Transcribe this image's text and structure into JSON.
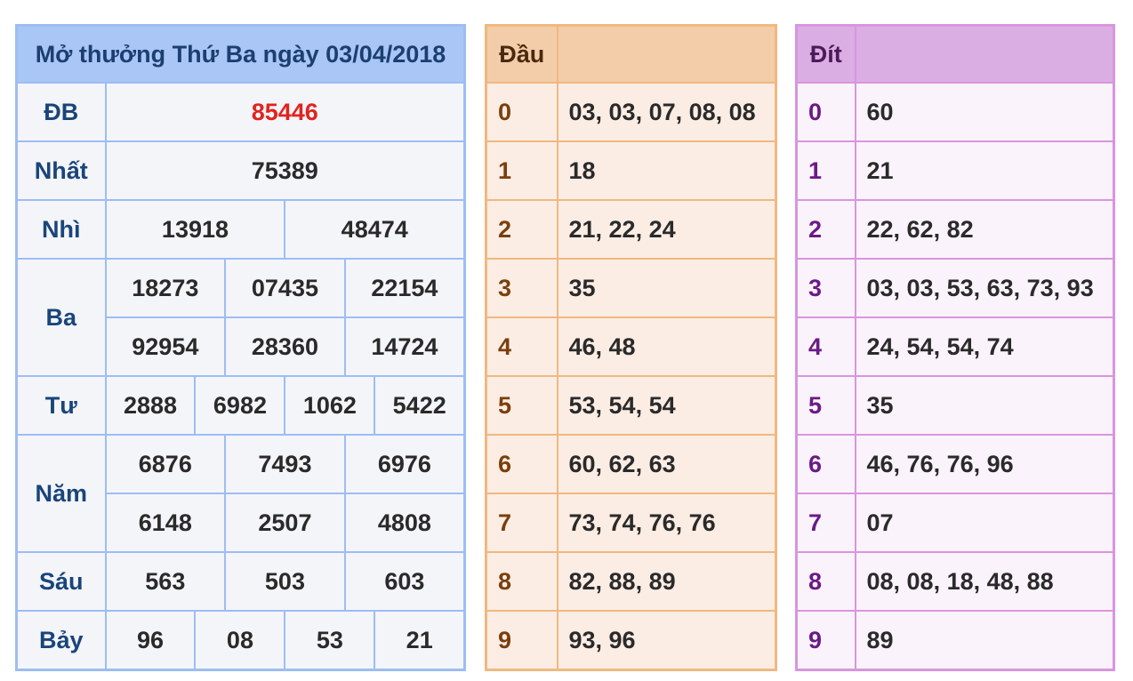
{
  "results": {
    "title": "Mở thưởng Thứ Ba ngày 03/04/2018",
    "db": {
      "label": "ĐB",
      "value": "85446"
    },
    "nhat": {
      "label": "Nhất",
      "value": "75389"
    },
    "nhi": {
      "label": "Nhì",
      "values": [
        "13918",
        "48474"
      ]
    },
    "ba": {
      "label": "Ba",
      "values": [
        "18273",
        "07435",
        "22154",
        "92954",
        "28360",
        "14724"
      ]
    },
    "tu": {
      "label": "Tư",
      "values": [
        "2888",
        "6982",
        "1062",
        "5422"
      ]
    },
    "nam": {
      "label": "Năm",
      "values": [
        "6876",
        "7493",
        "6976",
        "6148",
        "2507",
        "4808"
      ]
    },
    "sau": {
      "label": "Sáu",
      "values": [
        "563",
        "503",
        "603"
      ]
    },
    "bay": {
      "label": "Bảy",
      "values": [
        "96",
        "08",
        "53",
        "21"
      ]
    }
  },
  "dau": {
    "header": "Đầu",
    "rows": [
      {
        "digit": "0",
        "values": "03, 03, 07, 08, 08"
      },
      {
        "digit": "1",
        "values": "18"
      },
      {
        "digit": "2",
        "values": "21, 22, 24"
      },
      {
        "digit": "3",
        "values": "35"
      },
      {
        "digit": "4",
        "values": "46, 48"
      },
      {
        "digit": "5",
        "values": "53, 54, 54"
      },
      {
        "digit": "6",
        "values": "60, 62, 63"
      },
      {
        "digit": "7",
        "values": "73, 74, 76, 76"
      },
      {
        "digit": "8",
        "values": "82, 88, 89"
      },
      {
        "digit": "9",
        "values": "93, 96"
      }
    ]
  },
  "dit": {
    "header": "Đít",
    "rows": [
      {
        "digit": "0",
        "values": "60"
      },
      {
        "digit": "1",
        "values": "21"
      },
      {
        "digit": "2",
        "values": "22, 62, 82"
      },
      {
        "digit": "3",
        "values": "03, 03, 53, 63, 73, 93"
      },
      {
        "digit": "4",
        "values": "24, 54, 54, 74"
      },
      {
        "digit": "5",
        "values": "35"
      },
      {
        "digit": "6",
        "values": "46, 76, 76, 96"
      },
      {
        "digit": "7",
        "values": "07"
      },
      {
        "digit": "8",
        "values": "08, 08, 18, 48, 88"
      },
      {
        "digit": "9",
        "values": "89"
      }
    ]
  },
  "colors": {
    "special_prize": "#e0241f",
    "results_border": "#9dbdf3",
    "dau_border": "#f0b880",
    "dit_border": "#d995df"
  }
}
